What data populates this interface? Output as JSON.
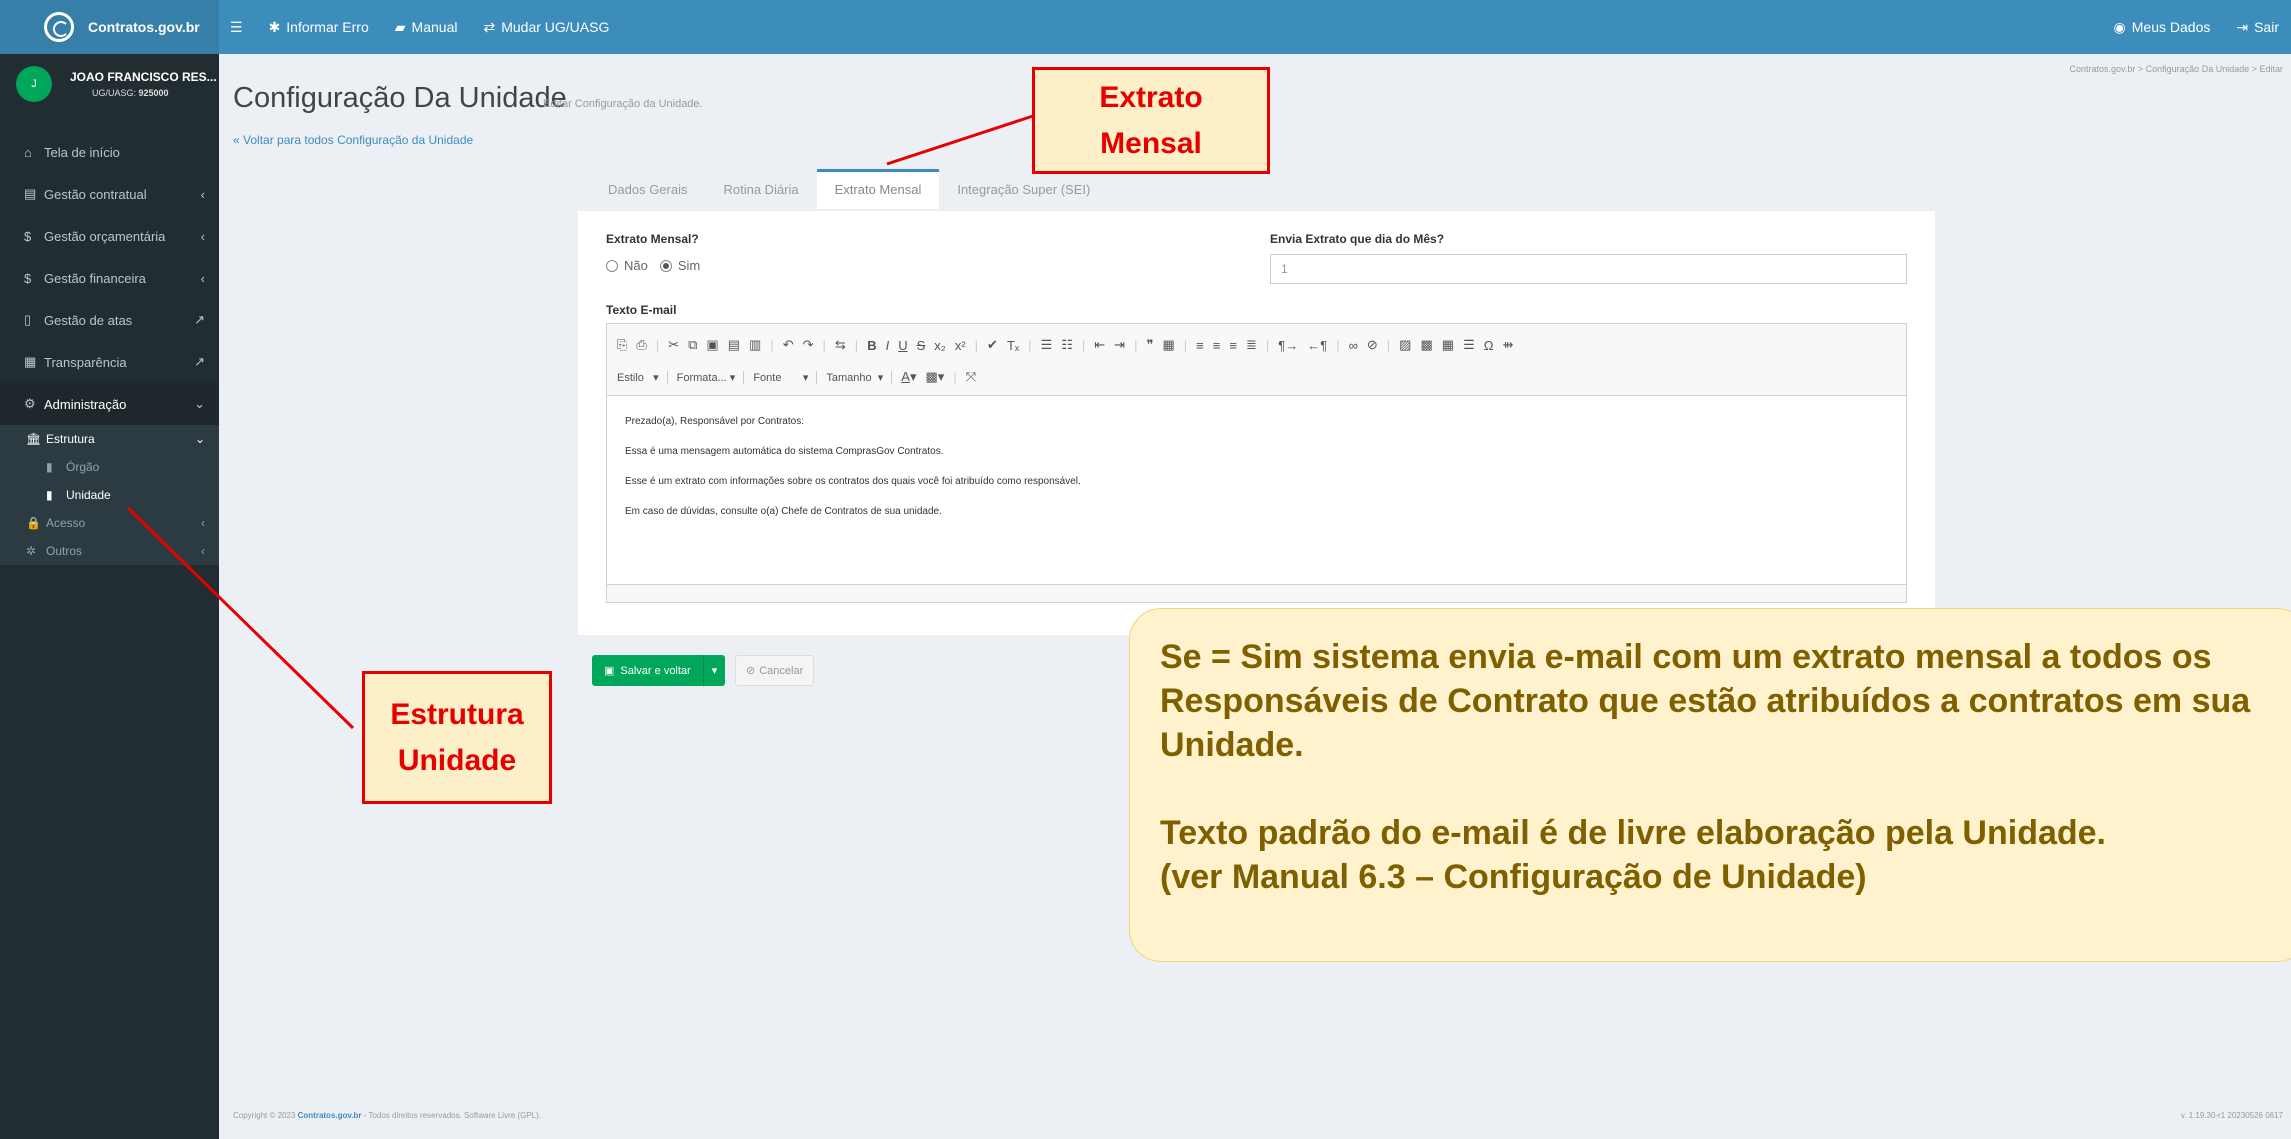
{
  "topbar": {
    "logo_text": "Contratos.gov.br",
    "nav": [
      {
        "icon": "bars-icon",
        "label": ""
      },
      {
        "icon": "bug-icon",
        "label": "Informar Erro"
      },
      {
        "icon": "book-icon",
        "label": "Manual"
      },
      {
        "icon": "exchange-icon",
        "label": "Mudar UG/UASG"
      }
    ],
    "right": [
      {
        "icon": "user-circle-icon",
        "label": "Meus Dados"
      },
      {
        "icon": "sign-out-icon",
        "label": "Sair"
      }
    ]
  },
  "user": {
    "initial": "J",
    "name": "JOAO FRANCISCO RES...",
    "uasg_label": "UG/UASG:",
    "uasg_value": "925000"
  },
  "sidebar": {
    "items": [
      {
        "icon": "home-icon",
        "label": "Tela de início",
        "right": ""
      },
      {
        "icon": "file-text-icon",
        "label": "Gestão contratual",
        "right": "‹"
      },
      {
        "icon": "dollar-icon",
        "label": "Gestão orçamentária",
        "right": "‹"
      },
      {
        "icon": "dollar-icon",
        "label": "Gestão financeira",
        "right": "‹"
      },
      {
        "icon": "file-icon",
        "label": "Gestão de atas",
        "right": "↗"
      },
      {
        "icon": "newspaper-icon",
        "label": "Transparência",
        "right": "↗"
      },
      {
        "icon": "cogs-icon",
        "label": "Administração",
        "right": "⌄"
      }
    ],
    "submenu": {
      "estrutura": {
        "label": "Estrutura",
        "right": "⌄"
      },
      "orgao": "Órgão",
      "unidade": "Unidade",
      "acesso": {
        "label": "Acesso",
        "right": "‹"
      },
      "outros": {
        "label": "Outros",
        "right": "‹"
      }
    }
  },
  "page": {
    "title": "Configuração Da Unidade",
    "subtitle": "Editar Configuração da Unidade.",
    "back_link": "« Voltar para todos Configuração da Unidade",
    "breadcrumb": "Contratos.gov.br  >  Configuração Da Unidade  >  Editar"
  },
  "tabs": [
    "Dados Gerais",
    "Rotina Diária",
    "Extrato Mensal",
    "Integração Super (SEI)"
  ],
  "active_tab": "Extrato Mensal",
  "form": {
    "extrato_label": "Extrato Mensal?",
    "radio_no": "Não",
    "radio_yes": "Sim",
    "selected": "Sim",
    "dia_label": "Envia Extrato que dia do Mês?",
    "dia_value": "1",
    "texto_label": "Texto E-mail",
    "editor_combos": [
      "Estilo",
      "Formata...",
      "Fonte",
      "Tamanho"
    ],
    "email_lines": [
      "Prezado(a), Responsável por Contratos:",
      "Essa é uma mensagem automática do sistema ComprasGov Contratos.",
      "Esse é um extrato com informações sobre os contratos dos quais você foi atribuído como responsável.",
      "Em caso de dúvidas, consulte o(a) Chefe de Contratos de sua unidade."
    ]
  },
  "buttons": {
    "save": "Salvar e voltar",
    "cancel": "Cancelar"
  },
  "footer": {
    "copyright_prefix": "Copyright © 2023",
    "brand": "Contratos.gov.br",
    "copyright_suffix": "- Todos direitos reservados. Software Livre (GPL).",
    "version": "v. 1.19.30-r1 20230526 0617"
  },
  "callouts": {
    "extrato": [
      "Extrato",
      "Mensal"
    ],
    "estrutura": [
      "Estrutura",
      "Unidade"
    ],
    "explanation": [
      "Se = Sim sistema envia e-mail com um extrato mensal a todos os",
      "Responsáveis de Contrato que estão atribuídos a contratos em sua",
      "Unidade.",
      "",
      "Texto padrão do e-mail é de livre elaboração pela Unidade.",
      "(ver Manual 6.3 – Configuração de Unidade)"
    ]
  },
  "colors": {
    "topbar": "#3c8dbc",
    "sidebar": "#222d32",
    "accent_green": "#00a65a",
    "callout_red": "#e60000",
    "callout_fill": "#fdf0c8",
    "explain_fill": "#fff2cc"
  }
}
